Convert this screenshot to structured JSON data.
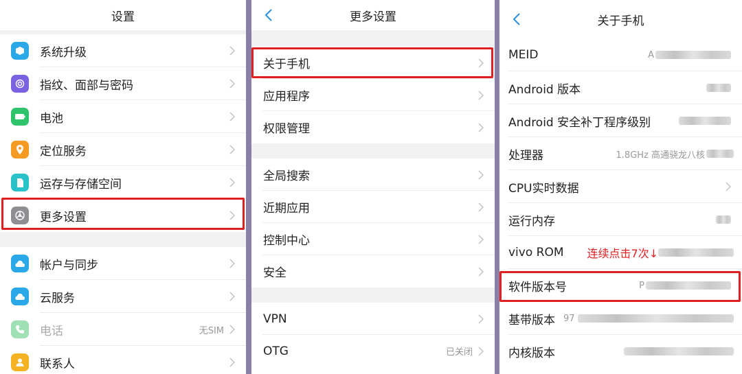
{
  "panel1": {
    "title": "设置",
    "items": [
      {
        "label": "系统升级",
        "color": "#2aa8e8"
      },
      {
        "label": "指纹、面部与密码",
        "color": "#7b62e0"
      },
      {
        "label": "电池",
        "color": "#2fc36b"
      },
      {
        "label": "定位服务",
        "color": "#f59a23"
      },
      {
        "label": "运存与存储空间",
        "color": "#28c2c8"
      },
      {
        "label": "更多设置",
        "color": "#8e8e93"
      },
      {
        "label": "帐户与同步",
        "color": "#2aa8e8"
      },
      {
        "label": "云服务",
        "color": "#2aa8e8"
      },
      {
        "label": "电话",
        "value": "无SIM",
        "color": "#9fe0b5"
      },
      {
        "label": "联系人",
        "color": "#f5b323"
      }
    ]
  },
  "panel2": {
    "title": "更多设置",
    "items": [
      {
        "label": "关于手机"
      },
      {
        "label": "应用程序"
      },
      {
        "label": "权限管理"
      },
      {
        "label": "全局搜索"
      },
      {
        "label": "近期应用"
      },
      {
        "label": "控制中心"
      },
      {
        "label": "安全"
      },
      {
        "label": "VPN"
      },
      {
        "label": "OTG",
        "value": "已关闭"
      }
    ]
  },
  "panel3": {
    "title": "关于手机",
    "items": [
      {
        "label": "MEID",
        "value": "A"
      },
      {
        "label": "Android 版本"
      },
      {
        "label": "Android 安全补丁程序级别"
      },
      {
        "label": "处理器",
        "value": "1.8GHz 高通骁龙八核"
      },
      {
        "label": "CPU实时数据"
      },
      {
        "label": "运行内存"
      },
      {
        "label": "vivo ROM",
        "annotation": "连续点击7次↓"
      },
      {
        "label": "软件版本号",
        "value": "P"
      },
      {
        "label": "基带版本",
        "value": "97"
      },
      {
        "label": "内核版本"
      }
    ]
  },
  "colors": {
    "highlight": "#e02020",
    "accent": "#2a8fe0"
  }
}
